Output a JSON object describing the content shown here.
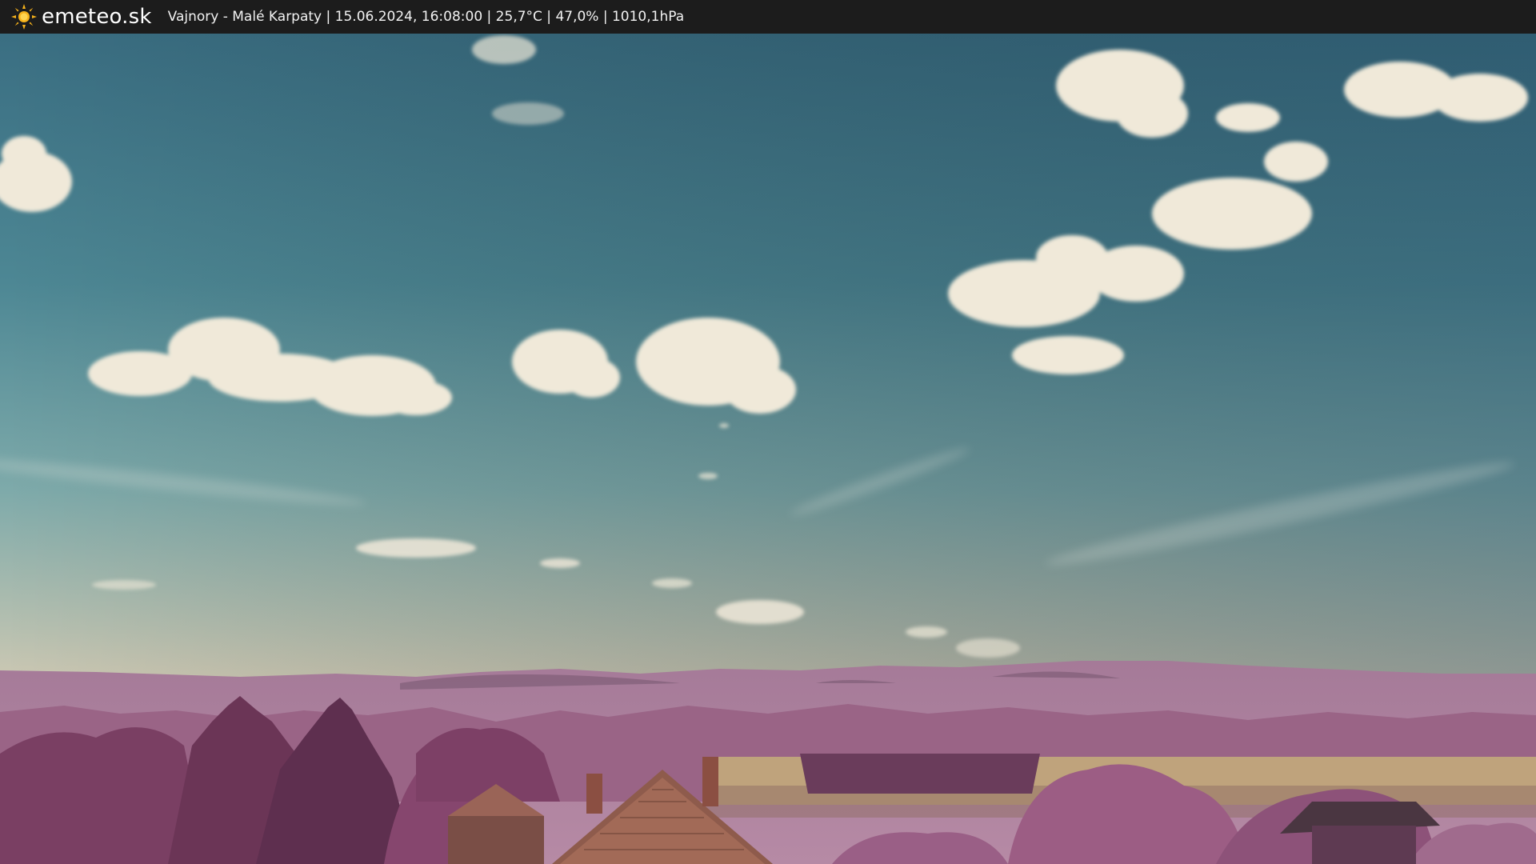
{
  "header": {
    "brand": "emeteo.sk",
    "logo_icon": "sun-icon",
    "station_text": "Vajnory - Malé Karpaty | 15.06.2024, 16:08:00 | 25,7°C | 47,0% | 1010,1hPa"
  },
  "colors": {
    "bar_background": "#1c1c1c",
    "sun_yellow": "#f6b21b",
    "sky_top": "#3f7386",
    "sky_horizon": "#c9c7b6",
    "hills": "#b085a3",
    "foliage": "#8a4f72"
  }
}
